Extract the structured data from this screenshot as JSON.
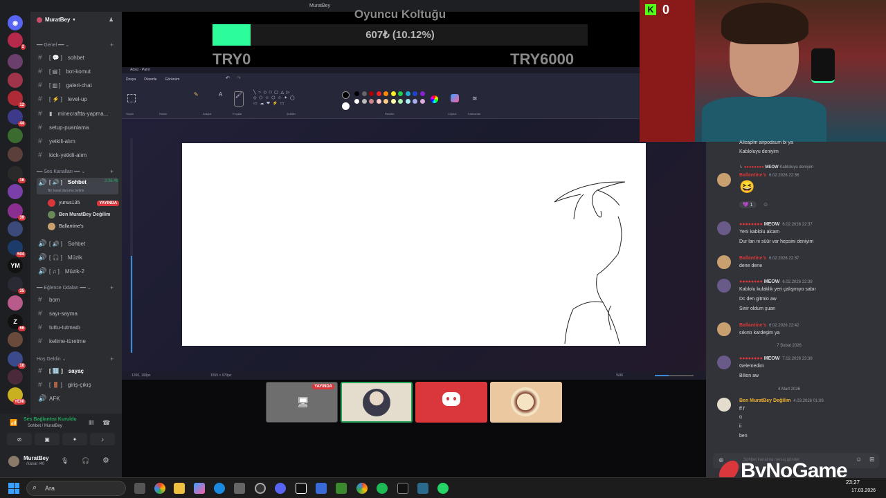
{
  "window": {
    "title": "MuratBey"
  },
  "server": {
    "name": "MuratBey"
  },
  "rail": {
    "badges": [
      "2",
      "44",
      "12",
      "39",
      "16",
      "504",
      "35",
      "66",
      "16",
      "10",
      "YENİ"
    ]
  },
  "categories": {
    "genel": "Genel",
    "ses": "Ses Kanalları",
    "eglence": "Eğlence Odaları",
    "hosgeldin": "Hoş Geldin"
  },
  "channels": {
    "sohbet": "sohbet",
    "bot_komut": "bot-komut",
    "galeri_chat": "galeri-chat",
    "level_up": "level-up",
    "minecraft": "minecraftta-yapma...",
    "setup": "setup-puanlama",
    "yetkili": "yetkili-alım",
    "kick": "kick-yetkili-alım",
    "voice_sohbet": "Sohbet",
    "voice_time": "3:36:48",
    "voice_status": "Bir kanal durumu belirle",
    "voice_sohbet2": "Sohbet",
    "muzik": "Müzik",
    "muzik2": "Müzik-2",
    "bom": "bom",
    "sayi": "sayı-sayma",
    "tuttu": "tuttu-tutmadı",
    "kelime": "kelime-türetme",
    "sayac": "sayaç",
    "giris": "giriş-çıkış",
    "afk": "AFK"
  },
  "voice_users": [
    {
      "name": "yunus135",
      "badge": "YAYINDA"
    },
    {
      "name": "Ben MuratBey Değilim"
    },
    {
      "name": "Ballantine's"
    }
  ],
  "connection": {
    "status": "Ses Bağlantısı Kuruldu",
    "channel": "Sohbet / MuratBey"
  },
  "user": {
    "name": "MuratBey",
    "status": "/kasar /40"
  },
  "goal": {
    "title": "Oyuncu Koltuğu",
    "amount": "607₺ (10.12%)",
    "progress": 0.1012,
    "min": "TRY0",
    "max": "TRY6000",
    "color": "#2dfc9a"
  },
  "paint": {
    "title": "Adsız - Paint",
    "menu": [
      "Dosya",
      "Düzenle",
      "Görünüm"
    ],
    "groups": [
      "Seçim",
      "Resim",
      "Araçlar",
      "Fırçalar",
      "Şekiller",
      "Renkler",
      "Copilot",
      "Katmanlar"
    ],
    "status_pos": "1260, 199px",
    "status_size": "1555 × 679px",
    "zoom": "%96"
  },
  "tiles": {
    "live_badge": "YAYINDA"
  },
  "kick_count": "0",
  "chat": {
    "top1": "Alicaplm airpodsum bi ya",
    "top2": "Kabloluyu deniyim",
    "reply_tag": "MEOW",
    "reply_text": "Kabloluyu deniyim",
    "messages": [
      {
        "name": "Ballantine's",
        "time": "6.02.2026 22:36",
        "lines": [
          "😆"
        ],
        "reaction": "1"
      },
      {
        "name": "MEOW",
        "time": "6.02.2026 22:37",
        "lines": [
          "Yeni kablolu alcam",
          "Dur lan ni süür var hepsini deniyim"
        ]
      },
      {
        "name": "Ballantine's",
        "time": "6.02.2026 22:37",
        "lines": [
          "dene dene"
        ]
      },
      {
        "name": "MEOW",
        "time": "6.02.2026 22:38",
        "lines": [
          "Kablolu kulaklık yeri çalışmıyo sabır",
          "Dc den gitmio aw",
          "Sinir oldum şuan"
        ]
      },
      {
        "name": "Ballantine's",
        "time": "6.02.2026 22:42",
        "lines": [
          "sıkıntı kardeşim ya"
        ]
      },
      {
        "name": "MEOW",
        "time": "7.02.2026 23:38",
        "lines": [
          "Gelemedim",
          "Bilion aw"
        ]
      },
      {
        "name": "Ben MuratBey Değilim",
        "time": "4.03.2026 01:09",
        "lines": [
          "ff f",
          "ü",
          "ii",
          "ben"
        ]
      }
    ],
    "sep1": "7 Şubat 2026",
    "sep2": "4 Mart 2026",
    "input_placeholder": "Sohbet kanalına mesaj gönder"
  },
  "watermark": "ByNoGame",
  "taskbar": {
    "search": "Ara",
    "time": "23:27",
    "date": "17.03.2026"
  }
}
